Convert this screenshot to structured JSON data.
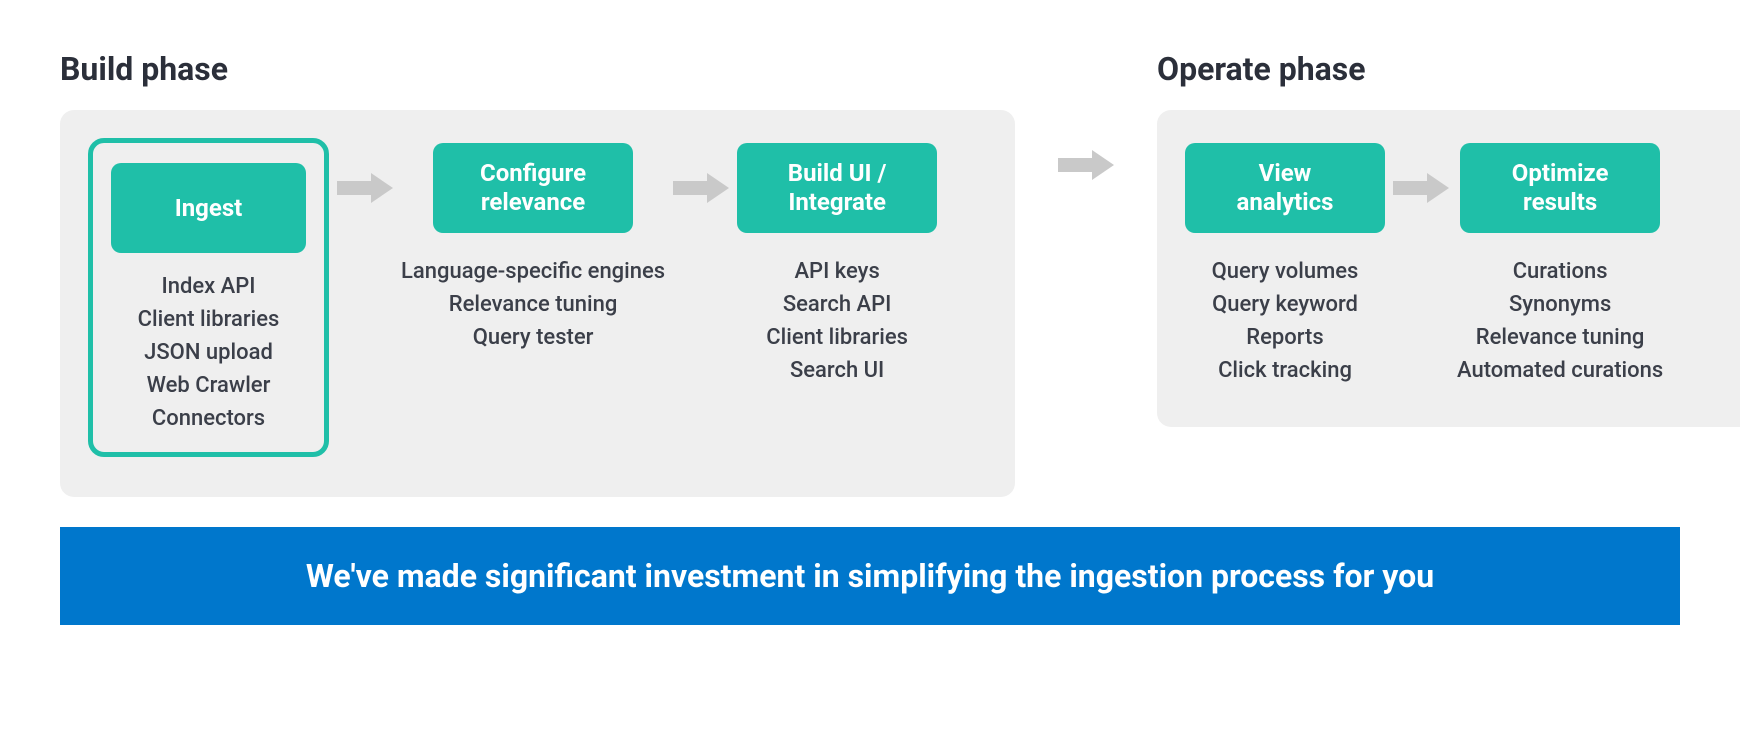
{
  "phases": {
    "build": {
      "title": "Build phase",
      "steps": [
        {
          "label_line1": "Ingest",
          "label_line2": "",
          "features": [
            "Index API",
            "Client libraries",
            "JSON upload",
            "Web Crawler",
            "Connectors"
          ],
          "highlighted": true
        },
        {
          "label_line1": "Configure",
          "label_line2": "relevance",
          "features": [
            "Language-specific engines",
            "Relevance tuning",
            "Query tester"
          ],
          "highlighted": false
        },
        {
          "label_line1": "Build UI /",
          "label_line2": "Integrate",
          "features": [
            "API keys",
            "Search API",
            "Client libraries",
            "Search UI"
          ],
          "highlighted": false
        }
      ]
    },
    "operate": {
      "title": "Operate phase",
      "steps": [
        {
          "label_line1": "View",
          "label_line2": "analytics",
          "features": [
            "Query volumes",
            "Query keyword",
            "Reports",
            "Click tracking"
          ],
          "highlighted": false
        },
        {
          "label_line1": "Optimize",
          "label_line2": "results",
          "features": [
            "Curations",
            "Synonyms",
            "Relevance tuning",
            "Automated curations"
          ],
          "highlighted": false
        }
      ]
    }
  },
  "banner": "We've made significant investment in simplifying the ingestion process for you",
  "colors": {
    "accent": "#1fbfa8",
    "banner": "#0077cc",
    "panel": "#efefef",
    "arrow": "#c9c9c9",
    "text": "#2b2f3a"
  }
}
